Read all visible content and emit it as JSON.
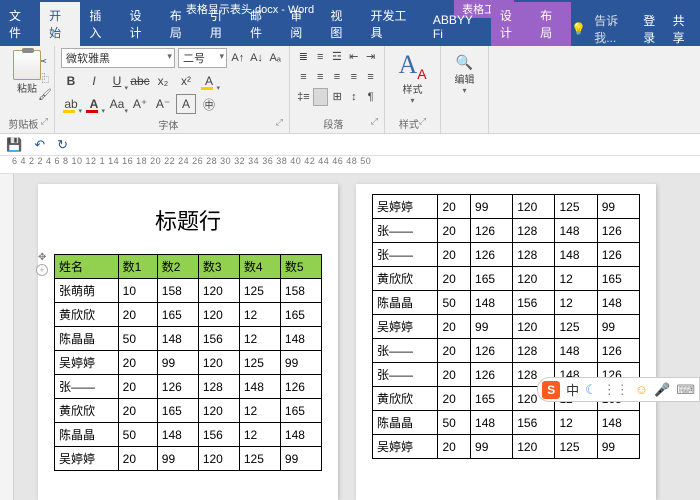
{
  "titlebar": {
    "filename": "表格显示表头.docx - Word",
    "tool_tab": "表格工具"
  },
  "tabs": {
    "file": "文件",
    "home": "开始",
    "insert": "插入",
    "design": "设计",
    "layout": "布局",
    "references": "引用",
    "mailings": "邮件",
    "review": "审阅",
    "view": "视图",
    "developer": "开发工具",
    "abbyy": "ABBYY Fi",
    "tdesign": "设计",
    "tlayout": "布局",
    "tellme": "告诉我...",
    "login": "登录",
    "share": "共享"
  },
  "ribbon": {
    "clipboard": {
      "paste": "粘贴",
      "label": "剪贴板"
    },
    "font": {
      "name": "微软雅黑",
      "size": "二号",
      "label": "字体"
    },
    "paragraph": {
      "label": "段落"
    },
    "styles": {
      "text": "样式",
      "label": "样式"
    },
    "editing": {
      "text": "编辑"
    }
  },
  "ruler": "6  4  2     2  4  6  8  10 12 1  14 16 18 20 22 24 26 28  30 32 34 36  38 40 42 44 46 48 50",
  "document": {
    "title": "标题行",
    "headers": [
      "姓名",
      "数1",
      "数2",
      "数3",
      "数4",
      "数5"
    ],
    "page1_rows": [
      [
        "张萌萌",
        "10",
        "158",
        "120",
        "125",
        "158"
      ],
      [
        "黄欣欣",
        "20",
        "165",
        "120",
        "12",
        "165"
      ],
      [
        "陈晶晶",
        "50",
        "148",
        "156",
        "12",
        "148"
      ],
      [
        "吴婷婷",
        "20",
        "99",
        "120",
        "125",
        "99"
      ],
      [
        "张——",
        "20",
        "126",
        "128",
        "148",
        "126"
      ],
      [
        "黄欣欣",
        "20",
        "165",
        "120",
        "12",
        "165"
      ],
      [
        "陈晶晶",
        "50",
        "148",
        "156",
        "12",
        "148"
      ],
      [
        "吴婷婷",
        "20",
        "99",
        "120",
        "125",
        "99"
      ]
    ],
    "page2_rows": [
      [
        "吴婷婷",
        "20",
        "99",
        "120",
        "125",
        "99"
      ],
      [
        "张——",
        "20",
        "126",
        "128",
        "148",
        "126"
      ],
      [
        "张——",
        "20",
        "126",
        "128",
        "148",
        "126"
      ],
      [
        "黄欣欣",
        "20",
        "165",
        "120",
        "12",
        "165"
      ],
      [
        "陈晶晶",
        "50",
        "148",
        "156",
        "12",
        "148"
      ],
      [
        "吴婷婷",
        "20",
        "99",
        "120",
        "125",
        "99"
      ],
      [
        "张——",
        "20",
        "126",
        "128",
        "148",
        "126"
      ],
      [
        "张——",
        "20",
        "126",
        "128",
        "148",
        "126"
      ],
      [
        "黄欣欣",
        "20",
        "165",
        "120",
        "12",
        "165"
      ],
      [
        "陈晶晶",
        "50",
        "148",
        "156",
        "12",
        "148"
      ],
      [
        "吴婷婷",
        "20",
        "99",
        "120",
        "125",
        "99"
      ]
    ]
  },
  "ime": {
    "logo": "S",
    "cn": "中"
  }
}
